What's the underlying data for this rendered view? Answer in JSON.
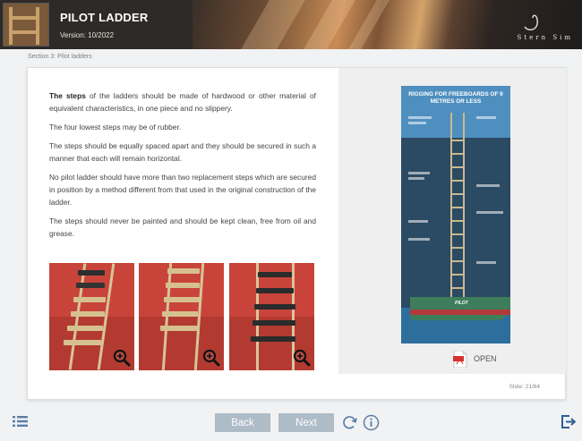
{
  "header": {
    "title": "PILOT LADDER",
    "version": "Version: 10/2022",
    "brand": "Stern Sim"
  },
  "breadcrumb": "Section 3: Pilot ladders",
  "content": {
    "p1_lead": "The steps",
    "p1_rest": " of the ladders should be made of hardwood or other material of equivalent characteristics, in one piece and no slippery.",
    "p2": "The four lowest steps may be of rubber.",
    "p3": "The steps should be equally spaced apart and they should be secured in such a manner that each will remain horizontal.",
    "p4": "No pilot ladder should have more than two replacement steps which are secured in position by a method different from that used in the original construction of the ladder.",
    "p5": "The steps should never be painted and should be kept clean, free from oil and grease."
  },
  "photos": [
    {
      "name": "ladder-photo-1",
      "zoom_icon": "zoom-in-icon"
    },
    {
      "name": "ladder-photo-2",
      "zoom_icon": "zoom-in-icon"
    },
    {
      "name": "ladder-photo-3",
      "zoom_icon": "zoom-in-icon"
    }
  ],
  "poster": {
    "title": "RIGGING FOR FREEBOARDS OF 9 METRES OR LESS",
    "boat_label": "PILOT"
  },
  "pdf": {
    "label": "OPEN",
    "icon": "pdf-icon"
  },
  "slide": "Slide: 21/64",
  "nav": {
    "back": "Back",
    "next": "Next",
    "menu_icon": "menu-list-icon",
    "reload_icon": "reload-icon",
    "info_icon": "info-icon",
    "exit_icon": "exit-icon"
  },
  "colors": {
    "nav_button": "#aebcc8",
    "header_bg": "#2e2a27",
    "accent_red": "#c8443a",
    "icon_blue": "#5b7da8"
  }
}
